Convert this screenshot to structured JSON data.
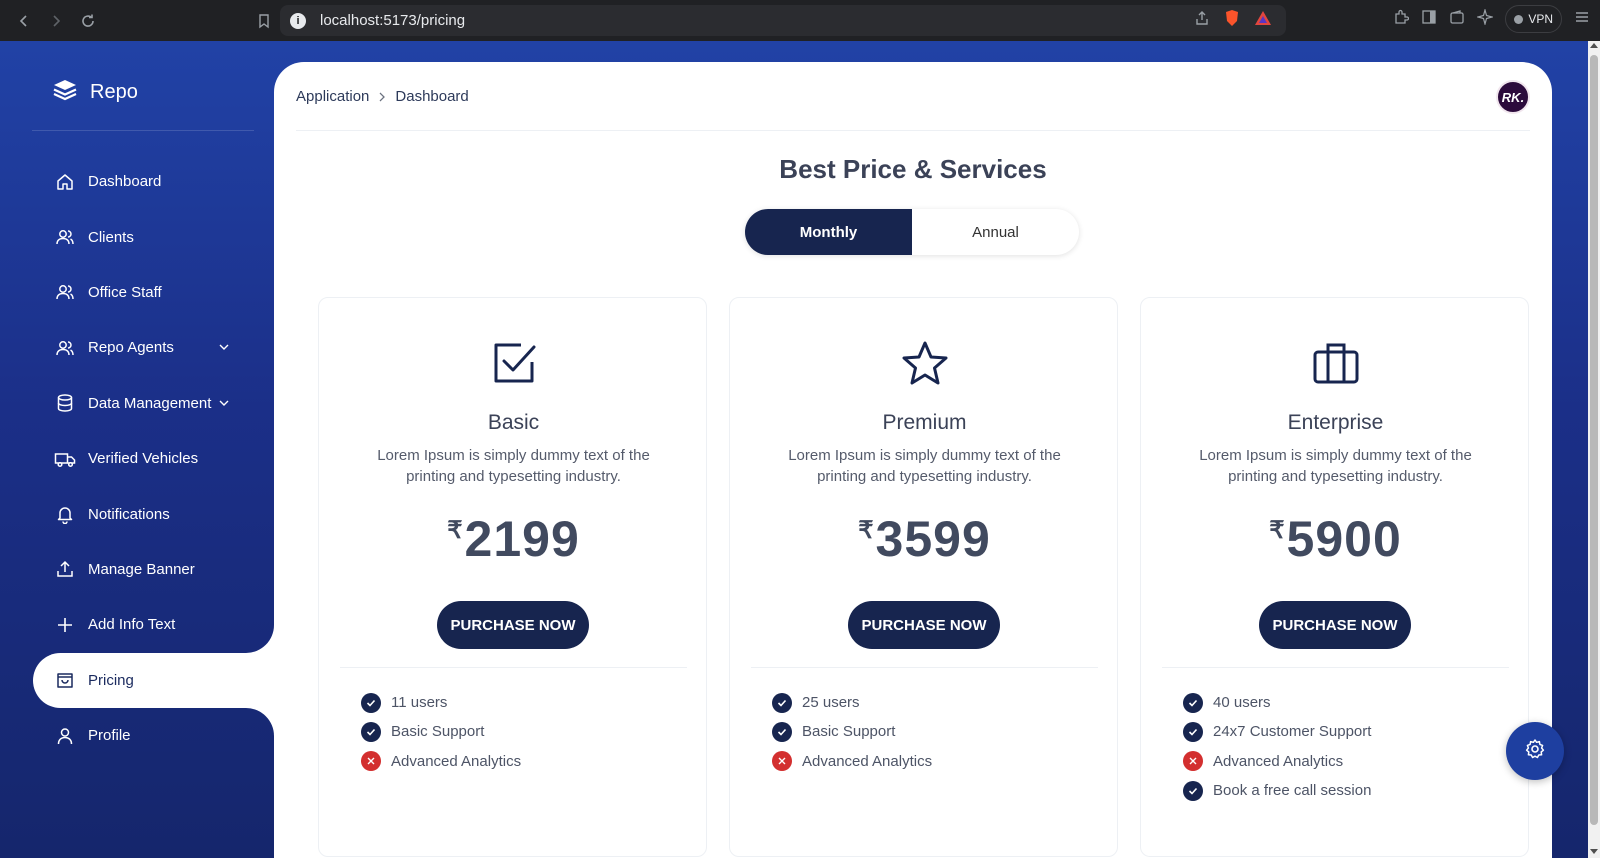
{
  "browser": {
    "url": "localhost:5173/pricing",
    "vpn_label": "VPN"
  },
  "sidebar": {
    "logo_text": "Repo",
    "items": [
      {
        "label": "Dashboard",
        "icon": "home-icon"
      },
      {
        "label": "Clients",
        "icon": "users-icon"
      },
      {
        "label": "Office Staff",
        "icon": "users-icon"
      },
      {
        "label": "Repo Agents",
        "icon": "users-icon",
        "has_submenu": true
      },
      {
        "label": "Data Management",
        "icon": "database-icon",
        "has_submenu": true
      },
      {
        "label": "Verified Vehicles",
        "icon": "truck-icon"
      },
      {
        "label": "Notifications",
        "icon": "bell-icon"
      },
      {
        "label": "Manage Banner",
        "icon": "upload-icon"
      },
      {
        "label": "Add Info Text",
        "icon": "plus-icon"
      },
      {
        "label": "Pricing",
        "icon": "shopping-bag-icon",
        "active": true
      },
      {
        "label": "Profile",
        "icon": "user-icon"
      }
    ]
  },
  "header": {
    "breadcrumb": [
      "Application",
      "Dashboard"
    ],
    "avatar_text": "RK."
  },
  "main": {
    "title": "Best Price & Services",
    "billing_toggle": {
      "options": [
        "Monthly",
        "Annual"
      ],
      "selected": "Monthly"
    }
  },
  "plans": [
    {
      "name": "Basic",
      "icon": "check-square-icon",
      "description": "Lorem Ipsum is simply dummy text of the printing and typesetting industry.",
      "currency": "₹",
      "price": "2199",
      "button": "PURCHASE NOW",
      "features": [
        {
          "text": "11 users",
          "included": true
        },
        {
          "text": "Basic Support",
          "included": true
        },
        {
          "text": "Advanced Analytics",
          "included": false
        }
      ]
    },
    {
      "name": "Premium",
      "icon": "star-icon",
      "description": "Lorem Ipsum is simply dummy text of the printing and typesetting industry.",
      "currency": "₹",
      "price": "3599",
      "button": "PURCHASE NOW",
      "features": [
        {
          "text": "25 users",
          "included": true
        },
        {
          "text": "Basic Support",
          "included": true
        },
        {
          "text": "Advanced Analytics",
          "included": false
        }
      ]
    },
    {
      "name": "Enterprise",
      "icon": "briefcase-icon",
      "description": "Lorem Ipsum is simply dummy text of the printing and typesetting industry.",
      "currency": "₹",
      "price": "5900",
      "button": "PURCHASE NOW",
      "features": [
        {
          "text": "40 users",
          "included": true
        },
        {
          "text": "24x7 Customer Support",
          "included": true
        },
        {
          "text": "Advanced Analytics",
          "included": false
        },
        {
          "text": "Book a free call session",
          "included": true
        }
      ]
    }
  ],
  "colors": {
    "sidebar_bg": "#1c2f88",
    "primary_dark": "#17254f",
    "check": "#17254f",
    "cross": "#d32f2f",
    "fab": "#1e3fa0"
  }
}
